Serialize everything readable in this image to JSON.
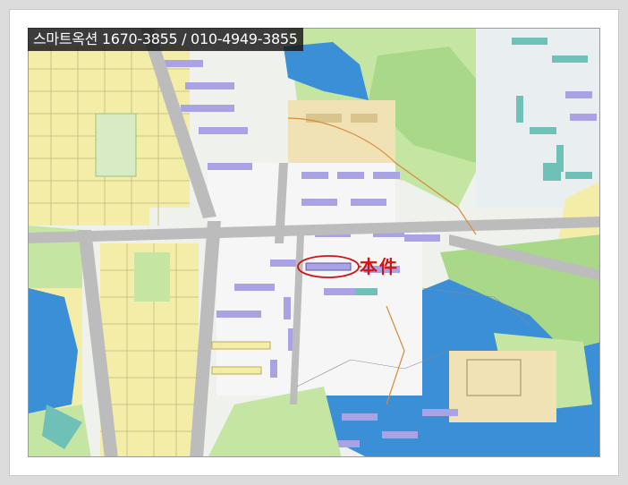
{
  "banner": {
    "text": "스마트옥션 1670-3855 / 010-4949-3855",
    "background": "#141414",
    "color": "#ffffff"
  },
  "subject": {
    "label": "本件",
    "marker_color": "#d21414"
  },
  "map_colors": {
    "residential_block": "#f3eda8",
    "park_green": "#c5e6a3",
    "forest_green": "#a9d889",
    "water_blue": "#3a8fd6",
    "road_gray": "#bcbcbc",
    "apartment_purple": "#a9a3e6",
    "school_tan": "#f1e2b5"
  }
}
